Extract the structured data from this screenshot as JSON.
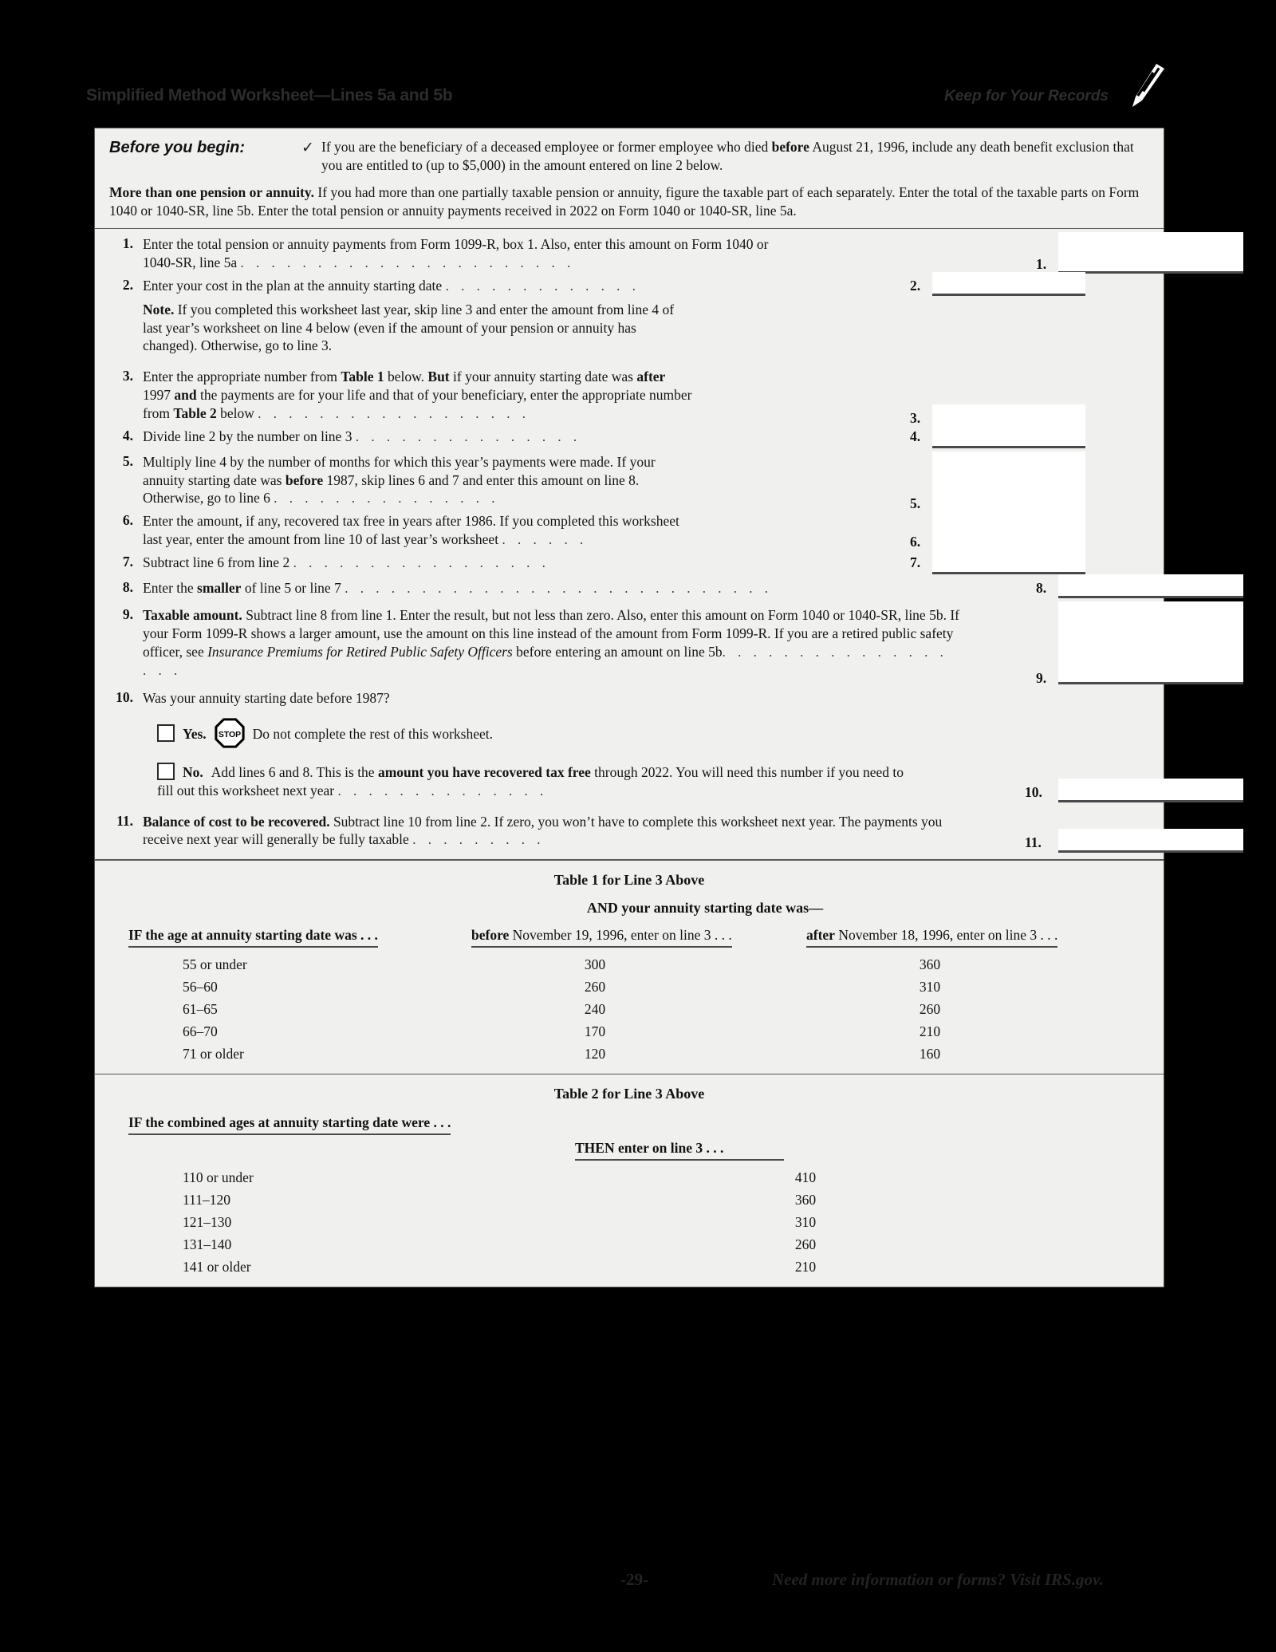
{
  "header": {
    "title": "Simplified Method Worksheet—Lines 5a and 5b",
    "keep_for_records": "Keep for Your Records",
    "pencil_icon": "pencil-icon"
  },
  "before_you_begin": {
    "label": "Before you begin:",
    "check_glyph": "✓",
    "bullet_text_1": "If you are the beneficiary of a deceased employee or former employee who died ",
    "bullet_bold_1": "before",
    "bullet_text_2": " August 21, 1996, include any death benefit exclusion that you are entitled to (up to $5,000) in the amount entered on line 2 below.",
    "more_bold": "More than one pension or annuity.",
    "more_text": " If you had more than one partially taxable pension or annuity, figure the taxable part of each separately. Enter the total of the taxable parts on Form 1040 or 1040-SR, line 5b. Enter the total pension or annuity payments received in 2022 on Form 1040 or 1040-SR, line 5a."
  },
  "lines": {
    "l1": {
      "num": "1.",
      "text_a": "Enter the total pension or annuity payments from Form 1099-R, box 1. Also, enter this amount on Form 1040 or",
      "text_b": "1040-SR, line 5a",
      "leader": ". . . . . . . . . . . . . . . . . . . . . .",
      "boxnum": "1."
    },
    "l2": {
      "num": "2.",
      "text_a": "Enter your cost in the plan at the annuity starting date",
      "leader": ". . . . . . . . . . . . .",
      "boxnum": "2.",
      "note_bold": "Note.",
      "note_text": " If you completed this worksheet last year, skip line 3 and enter the amount from line 4 of last year’s worksheet on line 4 below (even if the amount of your pension or annuity has changed). Otherwise, go to line 3."
    },
    "l3": {
      "num": "3.",
      "t1": "Enter the appropriate number from ",
      "b1": "Table 1",
      "t2": " below. ",
      "b2": "But",
      "t3": " if your annuity starting date was ",
      "b3": "after",
      "t4": " 1997 ",
      "b4": "and",
      "t5": " the payments are for your life and that of your beneficiary, enter the appropriate number from ",
      "b5": "Table 2",
      "t6": " below",
      "leader": ". . . . . . . . . . . . . . . . . .",
      "boxnum": "3."
    },
    "l4": {
      "num": "4.",
      "text_a": "Divide line 2 by the number on line 3",
      "leader": ". . . . . . . . . . . . . . .",
      "boxnum": "4."
    },
    "l5": {
      "num": "5.",
      "t1": "Multiply line 4 by the number of months for which this year’s payments were made. If your annuity starting date was ",
      "b1": "before",
      "t2": " 1987, skip lines 6 and 7 and enter this amount on line 8. Otherwise, go to line 6",
      "leader": ". . . . . . . . . . . . . . .",
      "boxnum": "5."
    },
    "l6": {
      "num": "6.",
      "text_a": "Enter the amount, if any, recovered tax free in years after 1986. If you completed this worksheet last year, enter the amount from line 10 of last year’s worksheet",
      "leader": ". . . . . .",
      "boxnum": "6."
    },
    "l7": {
      "num": "7.",
      "text_a": "Subtract line 6 from line 2",
      "leader": ". . . . . . . . . . . . . . . . .",
      "boxnum": "7."
    },
    "l8": {
      "num": "8.",
      "t1": "Enter the ",
      "b1": "smaller",
      "t2": " of line 5 or line 7",
      "leader": ". . . . . . . . . . . . . . . . . . . . . . . . . . . .",
      "boxnum": "8."
    },
    "l9": {
      "num": "9.",
      "b1": "Taxable amount.",
      "t1": " Subtract line 8 from line 1. Enter the result, but not less than zero. Also, enter this amount on Form 1040 or 1040-SR, line 5b. If your Form 1099-R shows a larger amount, use the amount on this line instead of the amount from Form 1099-R. If you are a retired public safety officer, see ",
      "i1": "Insurance Premiums for Retired Public Safety Officers",
      "t2": " before entering an amount on line 5b",
      "leader": ". . . . . . . . . . . . . . . . . .",
      "boxnum": "9."
    },
    "l10": {
      "num": "10.",
      "question": "Was your annuity starting date before 1987?",
      "yes_label": "Yes.",
      "stop_icon": "stop-sign-icon",
      "stop_text": "STOP",
      "yes_text": "Do not complete the rest of this worksheet.",
      "no_label": "No.",
      "no_t1": "Add lines 6 and 8. This is the ",
      "no_b1": "amount you have recovered tax free",
      "no_t2": " through 2022. You will need this number if you need to fill out this worksheet next year",
      "leader": ". . . . . . . . . . . . . .",
      "boxnum": "10."
    },
    "l11": {
      "num": "11.",
      "b1": "Balance of cost to be recovered.",
      "t1": " Subtract line 10 from line 2. If zero, you won’t have to complete this worksheet next year. The payments you receive next year will generally be fully taxable",
      "leader": ". . . . . . . . .",
      "boxnum": "11."
    }
  },
  "table1": {
    "title": "Table 1 for Line 3 Above",
    "and_header": "AND your annuity starting date was—",
    "col1_head_bold": "IF the age at annuity starting date was . . .",
    "col2_head_bold": "before",
    "col2_head_rest": " November 19, 1996, enter on line 3 . . .",
    "col3_head_bold": "after",
    "col3_head_rest": " November 18, 1996, enter on line 3 . . .",
    "rows": [
      {
        "age": "55 or under",
        "before": "300",
        "after": "360"
      },
      {
        "age": "56–60",
        "before": "260",
        "after": "310"
      },
      {
        "age": "61–65",
        "before": "240",
        "after": "260"
      },
      {
        "age": "66–70",
        "before": "170",
        "after": "210"
      },
      {
        "age": "71 or older",
        "before": "120",
        "after": "160"
      }
    ]
  },
  "table2": {
    "title": "Table 2 for Line 3 Above",
    "col1_head": "IF the combined ages at annuity starting date were . . .",
    "col2_head": "THEN enter on line 3 . . .",
    "rows": [
      {
        "ages": "110 or under",
        "value": "410"
      },
      {
        "ages": "111–120",
        "value": "360"
      },
      {
        "ages": "121–130",
        "value": "310"
      },
      {
        "ages": "131–140",
        "value": "260"
      },
      {
        "ages": "141 or older",
        "value": "210"
      }
    ]
  },
  "footer": {
    "page_number": "-29-",
    "note": "Need more information or forms? Visit IRS.gov."
  }
}
